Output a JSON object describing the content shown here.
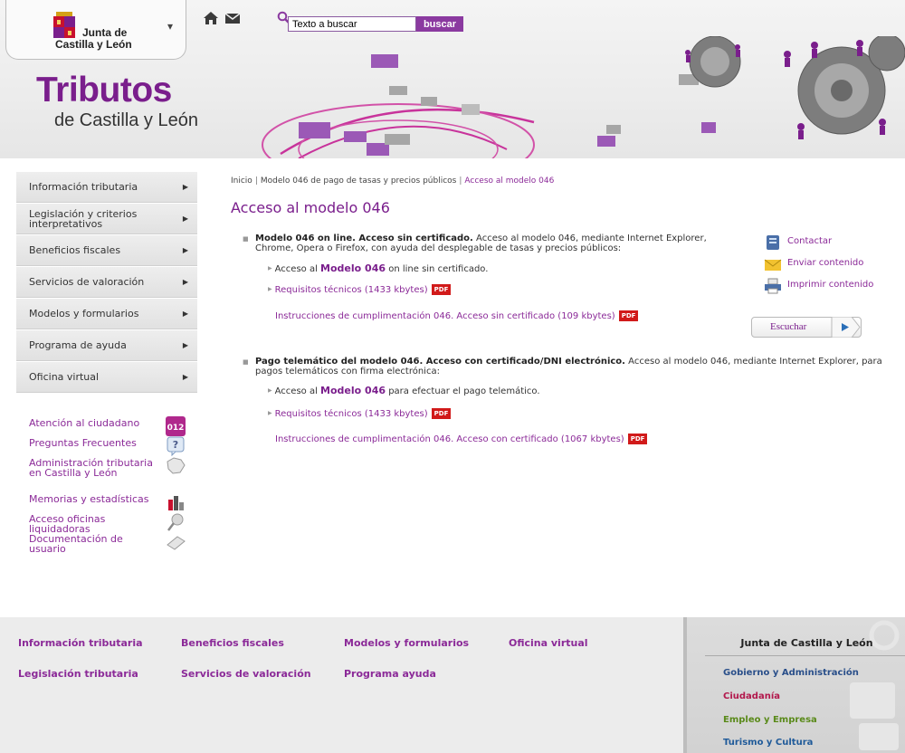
{
  "header": {
    "logo_line1": "Junta de",
    "logo_line2": "Castilla y León",
    "site_title": "Tributos",
    "site_subtitle": "de Castilla y León",
    "search": {
      "placeholder": "Texto a buscar",
      "button_label": "buscar"
    },
    "icons": [
      "home-icon",
      "mail-icon",
      "search-icon"
    ]
  },
  "leftnav": {
    "items": [
      {
        "label": "Información tributaria"
      },
      {
        "label": "Legislación y criterios interpretativos"
      },
      {
        "label": "Beneficios fiscales"
      },
      {
        "label": "Servicios de valoración"
      },
      {
        "label": "Modelos y formularios"
      },
      {
        "label": "Programa de ayuda"
      },
      {
        "label": "Oficina virtual"
      }
    ],
    "arrow": "▶"
  },
  "quicklinks": [
    {
      "label": "Atención al ciudadano",
      "icon": "012-phone-icon"
    },
    {
      "label": "Preguntas Frecuentes",
      "icon": "question-icon"
    },
    {
      "label": "Administración tributaria en Castilla y León",
      "icon": "map-icon"
    },
    {
      "label": "Memorias y estadísticas",
      "icon": "chart-icon"
    },
    {
      "label": "Acceso oficinas liquidadoras",
      "icon": "pin-icon"
    },
    {
      "label": "Documentación de usuario",
      "icon": "document-icon"
    }
  ],
  "breadcrumb": {
    "items": [
      "Inicio",
      "Modelo 046 de pago de tasas y precios públicos",
      "Acceso al modelo 046"
    ],
    "separator": "|"
  },
  "main": {
    "title": "Acceso al modelo 046",
    "sections": [
      {
        "heading": "Modelo 046 on line. Acceso sin certificado.",
        "text_line1": "Acceso al modelo 046, mediante Internet Explorer,",
        "text_line2": "Chrome, Opera o Firefox, con ayuda del desplegable de tasas y precios públicos:",
        "link_prefix": "Acceso al",
        "link_label": "Modelo 046",
        "link_suffix": "on line sin certificado.",
        "req_label": "Requisitos técnicos (1433 kbytes)",
        "instr_label": "Instrucciones de cumplimentación 046. Acceso sin certificado (109 kbytes)"
      },
      {
        "heading": "Pago telemático del modelo 046. Acceso con certificado/DNI electrónico.",
        "text_line1": "Acceso al modelo 046, mediante Internet Explorer, para",
        "text_line2": "pagos telemáticos con firma electrónica:",
        "link_prefix": "Acceso al",
        "link_label": "Modelo 046",
        "link_suffix": "para efectuar el pago telemático.",
        "req_label": "Requisitos técnicos (1433 kbytes)",
        "instr_label": "Instrucciones de cumplimentación 046. Acceso con certificado (1067 kbytes)"
      }
    ],
    "pdf_badge": "PDF"
  },
  "side_actions": {
    "contact": "Contactar",
    "send": "Enviar contenido",
    "print": "Imprimir contenido",
    "listen": "Escuchar"
  },
  "footer": {
    "col1": [
      "Información tributaria",
      "Legislación tributaria"
    ],
    "col2": [
      "Beneficios fiscales",
      "Servicios de valoración"
    ],
    "col3": [
      "Modelos y formularios",
      "Programa ayuda"
    ],
    "col4": [
      "Oficina virtual"
    ],
    "jcyl": {
      "title": "Junta de Castilla y León",
      "links": [
        {
          "label": "Gobierno y Administración",
          "color": "#2a4f8a"
        },
        {
          "label": "Ciudadanía",
          "color": "#b2184c"
        },
        {
          "label": "Empleo y Empresa",
          "color": "#5a8a1a"
        },
        {
          "label": "Turismo y Cultura",
          "color": "#1f5a99"
        }
      ]
    }
  },
  "colors": {
    "accent": "#7a1e8c",
    "link": "#8b2a98",
    "pdf": "#d11a1a"
  }
}
